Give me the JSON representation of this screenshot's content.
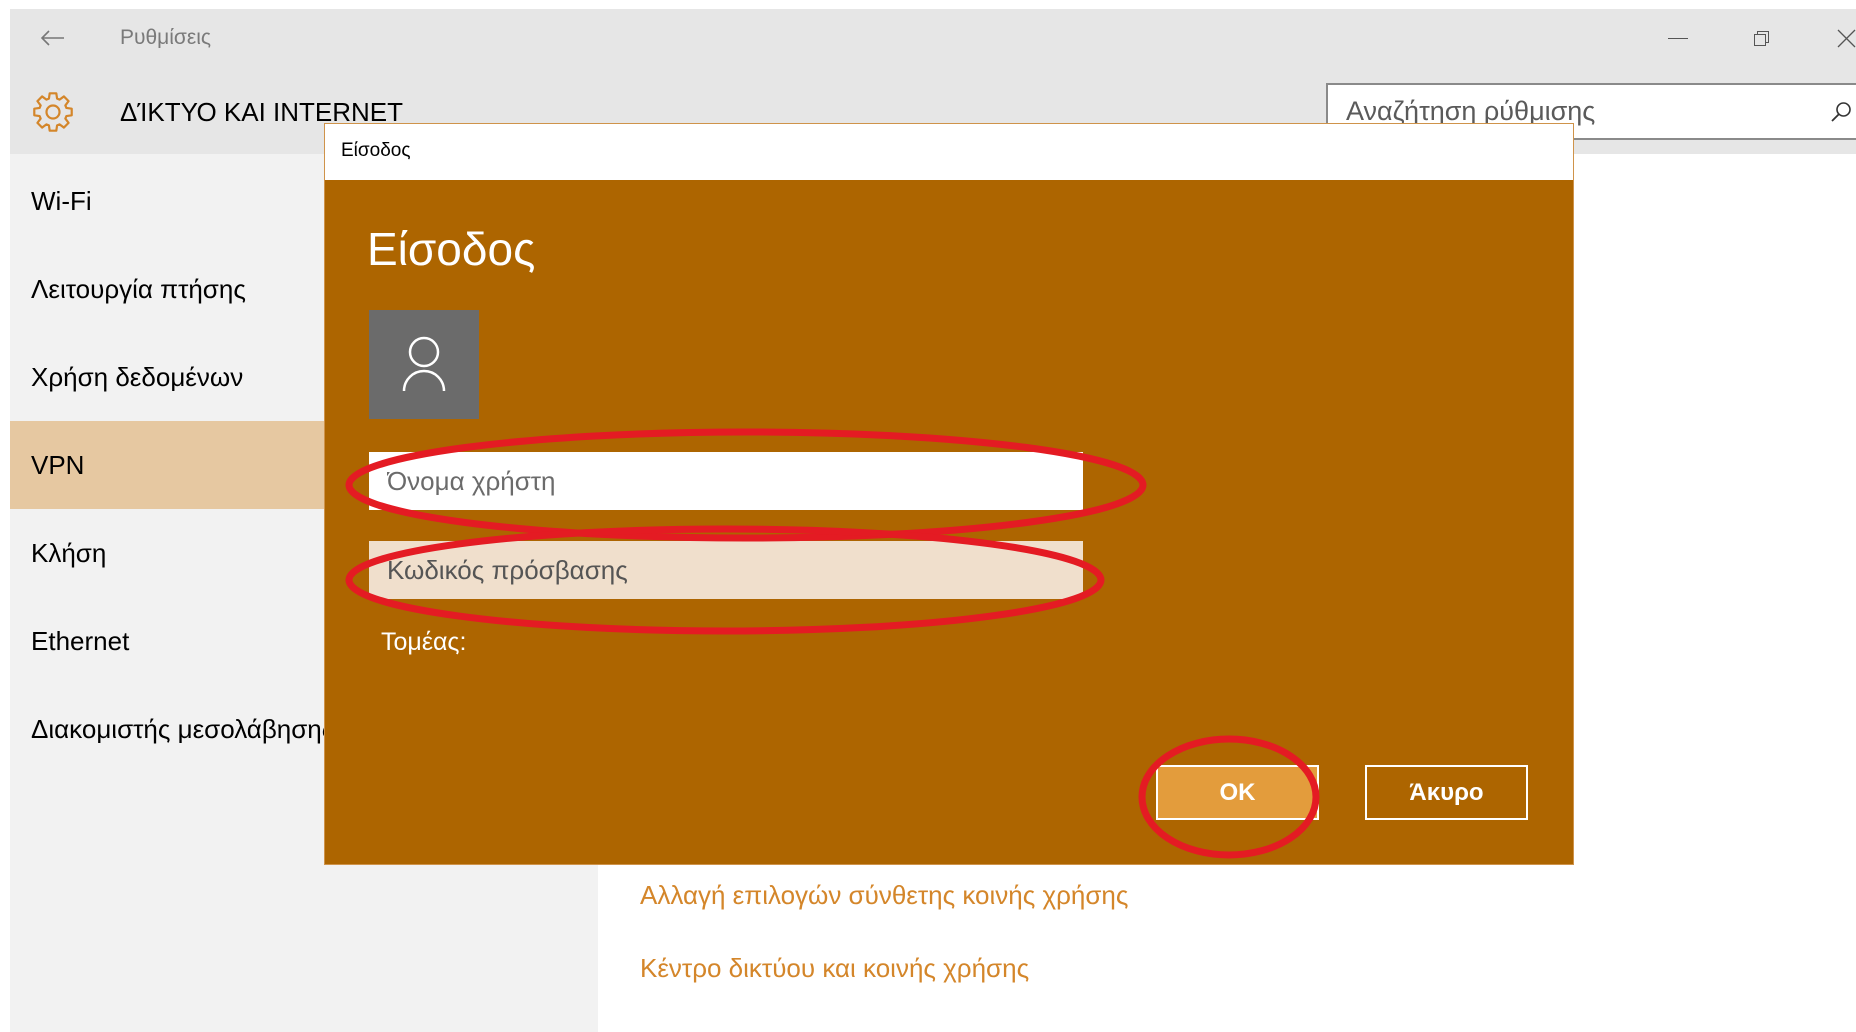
{
  "window": {
    "title": "Ρυθμίσεις",
    "back_icon": "back-arrow-icon",
    "minimize_icon": "minimize-icon",
    "restore_icon": "restore-icon",
    "close_icon": "close-icon"
  },
  "header": {
    "icon": "gear-icon",
    "title": "ΔΊΚΤΥΟ ΚΑΙ INTERNET"
  },
  "search": {
    "placeholder": "Αναζήτηση ρύθμισης",
    "icon": "search-icon"
  },
  "sidebar": {
    "selected_index": 3,
    "items": [
      {
        "label": "Wi-Fi"
      },
      {
        "label": "Λειτουργία πτήσης"
      },
      {
        "label": "Χρήση δεδομένων"
      },
      {
        "label": "VPN"
      },
      {
        "label": "Κλήση"
      },
      {
        "label": "Ethernet"
      },
      {
        "label": "Διακομιστής μεσολάβησης"
      }
    ]
  },
  "main": {
    "links": [
      {
        "label": "Αλλαγή επιλογών σύνθετης κοινής χρήσης"
      },
      {
        "label": "Κέντρο δικτύου και κοινής χρήσης"
      }
    ]
  },
  "dialog": {
    "window_title": "Είσοδος",
    "heading": "Είσοδος",
    "avatar_icon": "user-icon",
    "username": {
      "placeholder": "Όνομα χρήστη"
    },
    "password": {
      "placeholder": "Κωδικός πρόσβασης"
    },
    "domain_label": "Τομέας:",
    "ok_label": "OK",
    "cancel_label": "Άκυρο"
  },
  "colors": {
    "accent": "#ad6500",
    "accent_light": "#e39c3c",
    "link": "#d4862a",
    "selected_nav": "#e6c8a1",
    "password_field": "#f0dfcc",
    "annotation": "#e41b23"
  }
}
